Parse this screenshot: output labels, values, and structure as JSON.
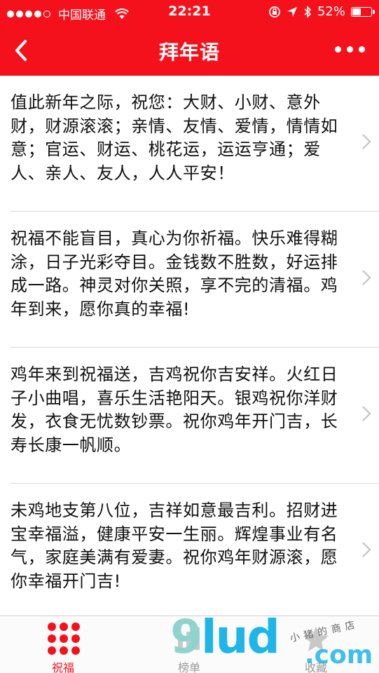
{
  "status_bar": {
    "carrier": "中国联通",
    "time": "22:21",
    "battery": "52%",
    "battery_level": 0.52,
    "signal_bars": 4,
    "signal_max": 5
  },
  "nav": {
    "title": "拜年语",
    "back_icon": "chevron-left-icon",
    "more_icon": "more-dots-icon"
  },
  "greetings": [
    {
      "text": "值此新年之际，祝您：大财、小财、意外财，财源滚滚；亲情、友情、爱情，情情如意；官运、财运、桃花运，运运亨通；爱人、亲人、友人，人人平安！"
    },
    {
      "text": "祝福不能盲目，真心为你祈福。快乐难得糊涂，日子光彩夺目。金钱数不胜数，好运排成一路。神灵对你关照，享不完的清福。鸡年到来，愿你真的幸福!"
    },
    {
      "text": "鸡年来到祝福送，吉鸡祝你吉安祥。火红日子小曲唱，喜乐生活艳阳天。银鸡祝你洋财发，衣食无忧数钞票。祝你鸡年开门吉，长寿长康一帆顺。"
    },
    {
      "text": "未鸡地支第八位，吉祥如意最吉利。招财进宝幸福溢，健康平安一生丽。辉煌事业有名气，家庭美满有爱妻。祝你鸡年财源滚，愿你幸福开门吉!"
    }
  ],
  "tabs": [
    {
      "label": "祝福",
      "icon": "grid-dots-icon",
      "active": true
    },
    {
      "label": "榜单",
      "icon": "chart-icon",
      "active": false
    },
    {
      "label": "收藏",
      "icon": "star-icon",
      "active": false
    }
  ],
  "watermark": {
    "brand_9": "9",
    "brand_lud": "lud",
    "domain": ".com",
    "shop_text": "小猪的商店"
  },
  "colors": {
    "accent": "#f5111c",
    "divider": "#d9d9d9",
    "text": "#111111"
  }
}
